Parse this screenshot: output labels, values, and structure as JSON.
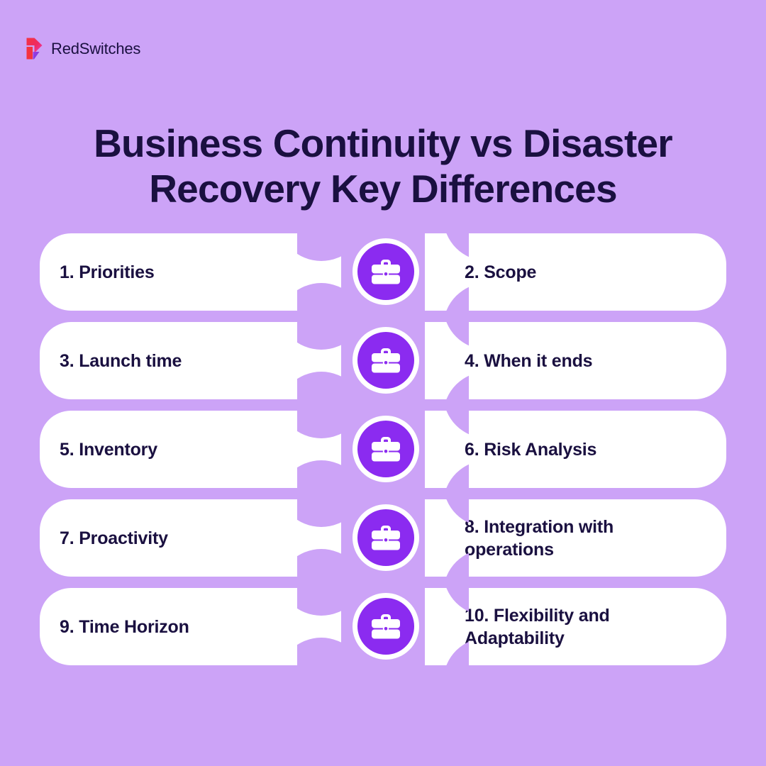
{
  "brand": {
    "name": "RedSwitches",
    "logo_icon": "redswitches-arrow-logo",
    "logo_colors": {
      "top": "#f5333f",
      "mid": "#e8236a",
      "accent": "#ef3dbb",
      "bottom": "#7b3fe4"
    }
  },
  "page": {
    "title": "Business Continuity vs Disaster Recovery Key Differences",
    "background_color": "#cca3f7",
    "text_color": "#1a1040",
    "badge_color": "#8b2bf0",
    "pill_color": "#ffffff"
  },
  "rows": [
    {
      "icon": "briefcase-icon",
      "left": "1. Priorities",
      "right": "2. Scope"
    },
    {
      "icon": "briefcase-icon",
      "left": " 3. Launch time",
      "right": "4. When it ends"
    },
    {
      "icon": "briefcase-icon",
      "left": "5. Inventory",
      "right": "6. Risk Analysis"
    },
    {
      "icon": "briefcase-icon",
      "left": "7. Proactivity",
      "right": "8. Integration with\noperations"
    },
    {
      "icon": "briefcase-icon",
      "left": "9. Time Horizon",
      "right": "10. Flexibility and\nAdaptability"
    }
  ]
}
